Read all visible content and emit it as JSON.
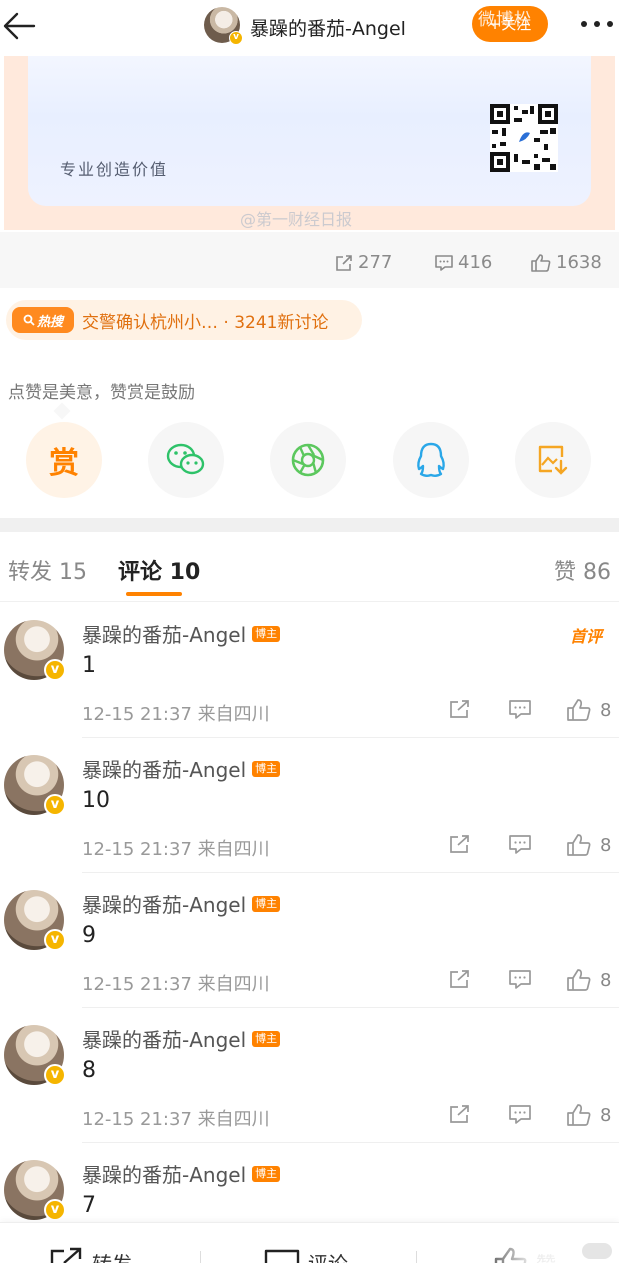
{
  "header": {
    "title": "暴躁的番茄-Angel",
    "follow_label": "+关注",
    "watermark": "微博松"
  },
  "post": {
    "slogan": "专业创造价值",
    "image_watermark": "@第一财经日报",
    "stats": {
      "reposts": "277",
      "comments": "416",
      "likes": "1638"
    }
  },
  "hot_search": {
    "tag": "热搜",
    "text": "交警确认杭州小… · 3241新讨论"
  },
  "reward": {
    "label": "点赞是美意，赞赏是鼓励",
    "reward_button": "赏",
    "share_targets": [
      "wechat-icon",
      "moments-icon",
      "qq-icon",
      "save-image-icon"
    ]
  },
  "tabs": {
    "repost": "转发 15",
    "comment": "评论 10",
    "like": "赞 86"
  },
  "comments": [
    {
      "name": "暴躁的番茄-Angel",
      "badge": "博主",
      "text": "1",
      "time": "12-15 21:37  来自四川",
      "likes": "8",
      "top_label": "首评"
    },
    {
      "name": "暴躁的番茄-Angel",
      "badge": "博主",
      "text": "10",
      "time": "12-15 21:37  来自四川",
      "likes": "8"
    },
    {
      "name": "暴躁的番茄-Angel",
      "badge": "博主",
      "text": "9",
      "time": "12-15 21:37  来自四川",
      "likes": "8"
    },
    {
      "name": "暴躁的番茄-Angel",
      "badge": "博主",
      "text": "8",
      "time": "12-15 21:37  来自四川",
      "likes": "8"
    },
    {
      "name": "暴躁的番茄-Angel",
      "badge": "博主",
      "text": "7",
      "time": "",
      "likes": ""
    }
  ],
  "bottom_bar": {
    "repost": "转发",
    "comment": "评论",
    "like": "赞"
  },
  "colors": {
    "accent": "#ff8200",
    "verified": "#f5b500"
  }
}
